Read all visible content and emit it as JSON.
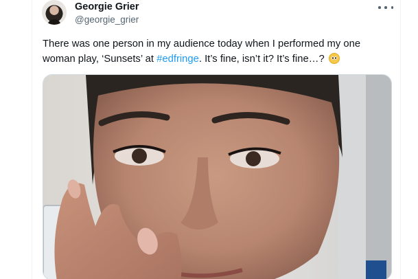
{
  "author": {
    "display_name": "Georgie Grier",
    "handle": "@georgie_grier"
  },
  "tweet": {
    "text_before": "There was one person in my audience today when I performed my one woman play, ‘Sunsets’ at ",
    "hashtag": "#edfringe",
    "text_after": ". It’s fine, isn’t it? It’s fine…? ",
    "emoji": "pleading-face-emoji"
  },
  "icons": {
    "more": "more-dots-icon",
    "avatar": "profile-photo",
    "media": "photo-of-tearful-woman"
  },
  "colors": {
    "text": "#0f1419",
    "secondary": "#536471",
    "link": "#1d9bf0",
    "border": "#cfd9de"
  }
}
